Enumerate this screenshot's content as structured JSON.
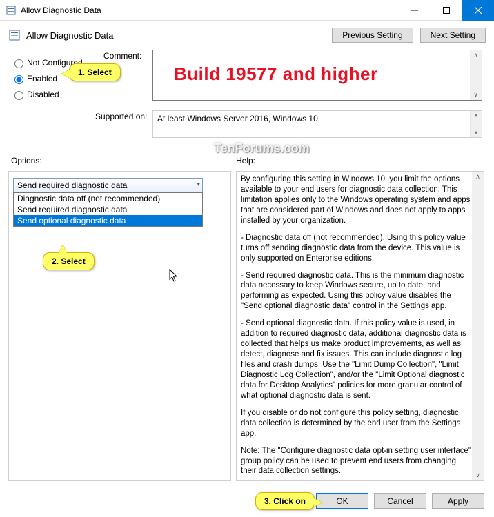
{
  "window": {
    "title": "Allow Diagnostic Data",
    "app_title": "Allow Diagnostic Data",
    "prev_btn": "Previous Setting",
    "next_btn": "Next Setting"
  },
  "radios": {
    "not_configured": "Not Configured",
    "enabled": "Enabled",
    "disabled": "Disabled"
  },
  "labels": {
    "comment": "Comment:",
    "supported": "Supported on:",
    "supported_value": "At least Windows Server 2016, Windows 10",
    "options": "Options:",
    "help": "Help:"
  },
  "combo": {
    "selected": "Send required diagnostic data",
    "items": [
      "Diagnostic data off (not recommended)",
      "Send required diagnostic data",
      "Send optional diagnostic data"
    ]
  },
  "help_text": {
    "p1": "By configuring this setting in Windows 10, you limit the options available to your end users for diagnostic data collection. This limitation applies only to the Windows operating system and apps that are considered part of Windows and does not apply to apps installed by your organization.",
    "p2": "   - Diagnostic data off (not recommended). Using this policy value turns off sending diagnostic data from the device. This value is only supported on Enterprise editions.",
    "p3": "   - Send required diagnostic data. This is the minimum diagnostic data necessary to keep Windows secure, up to date, and performing as expected. Using this policy value disables the \"Send optional diagnostic data\" control in the Settings app.",
    "p4": "   - Send optional diagnostic data. If this policy value is used, in addition to required diagnostic data, additional diagnostic data is collected that helps us make product improvements, as well as detect, diagnose and fix issues. This can include diagnostic log files and crash dumps. Use the \"Limit Dump Collection\", \"Limit Diagnostic Log Collection\", and/or the \"Limit Optional diagnostic data for Desktop Analytics\" policies for more granular control of what optional diagnostic data is sent.",
    "p5": "If you disable or do not configure this policy setting, diagnostic data collection is determined by the end user from the Settings app.",
    "p6": "Note: The \"Configure diagnostic data opt-in setting user interface\" group policy can be used to prevent end users from changing their data collection settings."
  },
  "buttons": {
    "ok": "OK",
    "cancel": "Cancel",
    "apply": "Apply"
  },
  "annotations": {
    "banner": "Build 19577 and higher",
    "watermark": "TenForums.com",
    "step1": "1. Select",
    "step2": "2. Select",
    "step3": "3. Click on"
  }
}
